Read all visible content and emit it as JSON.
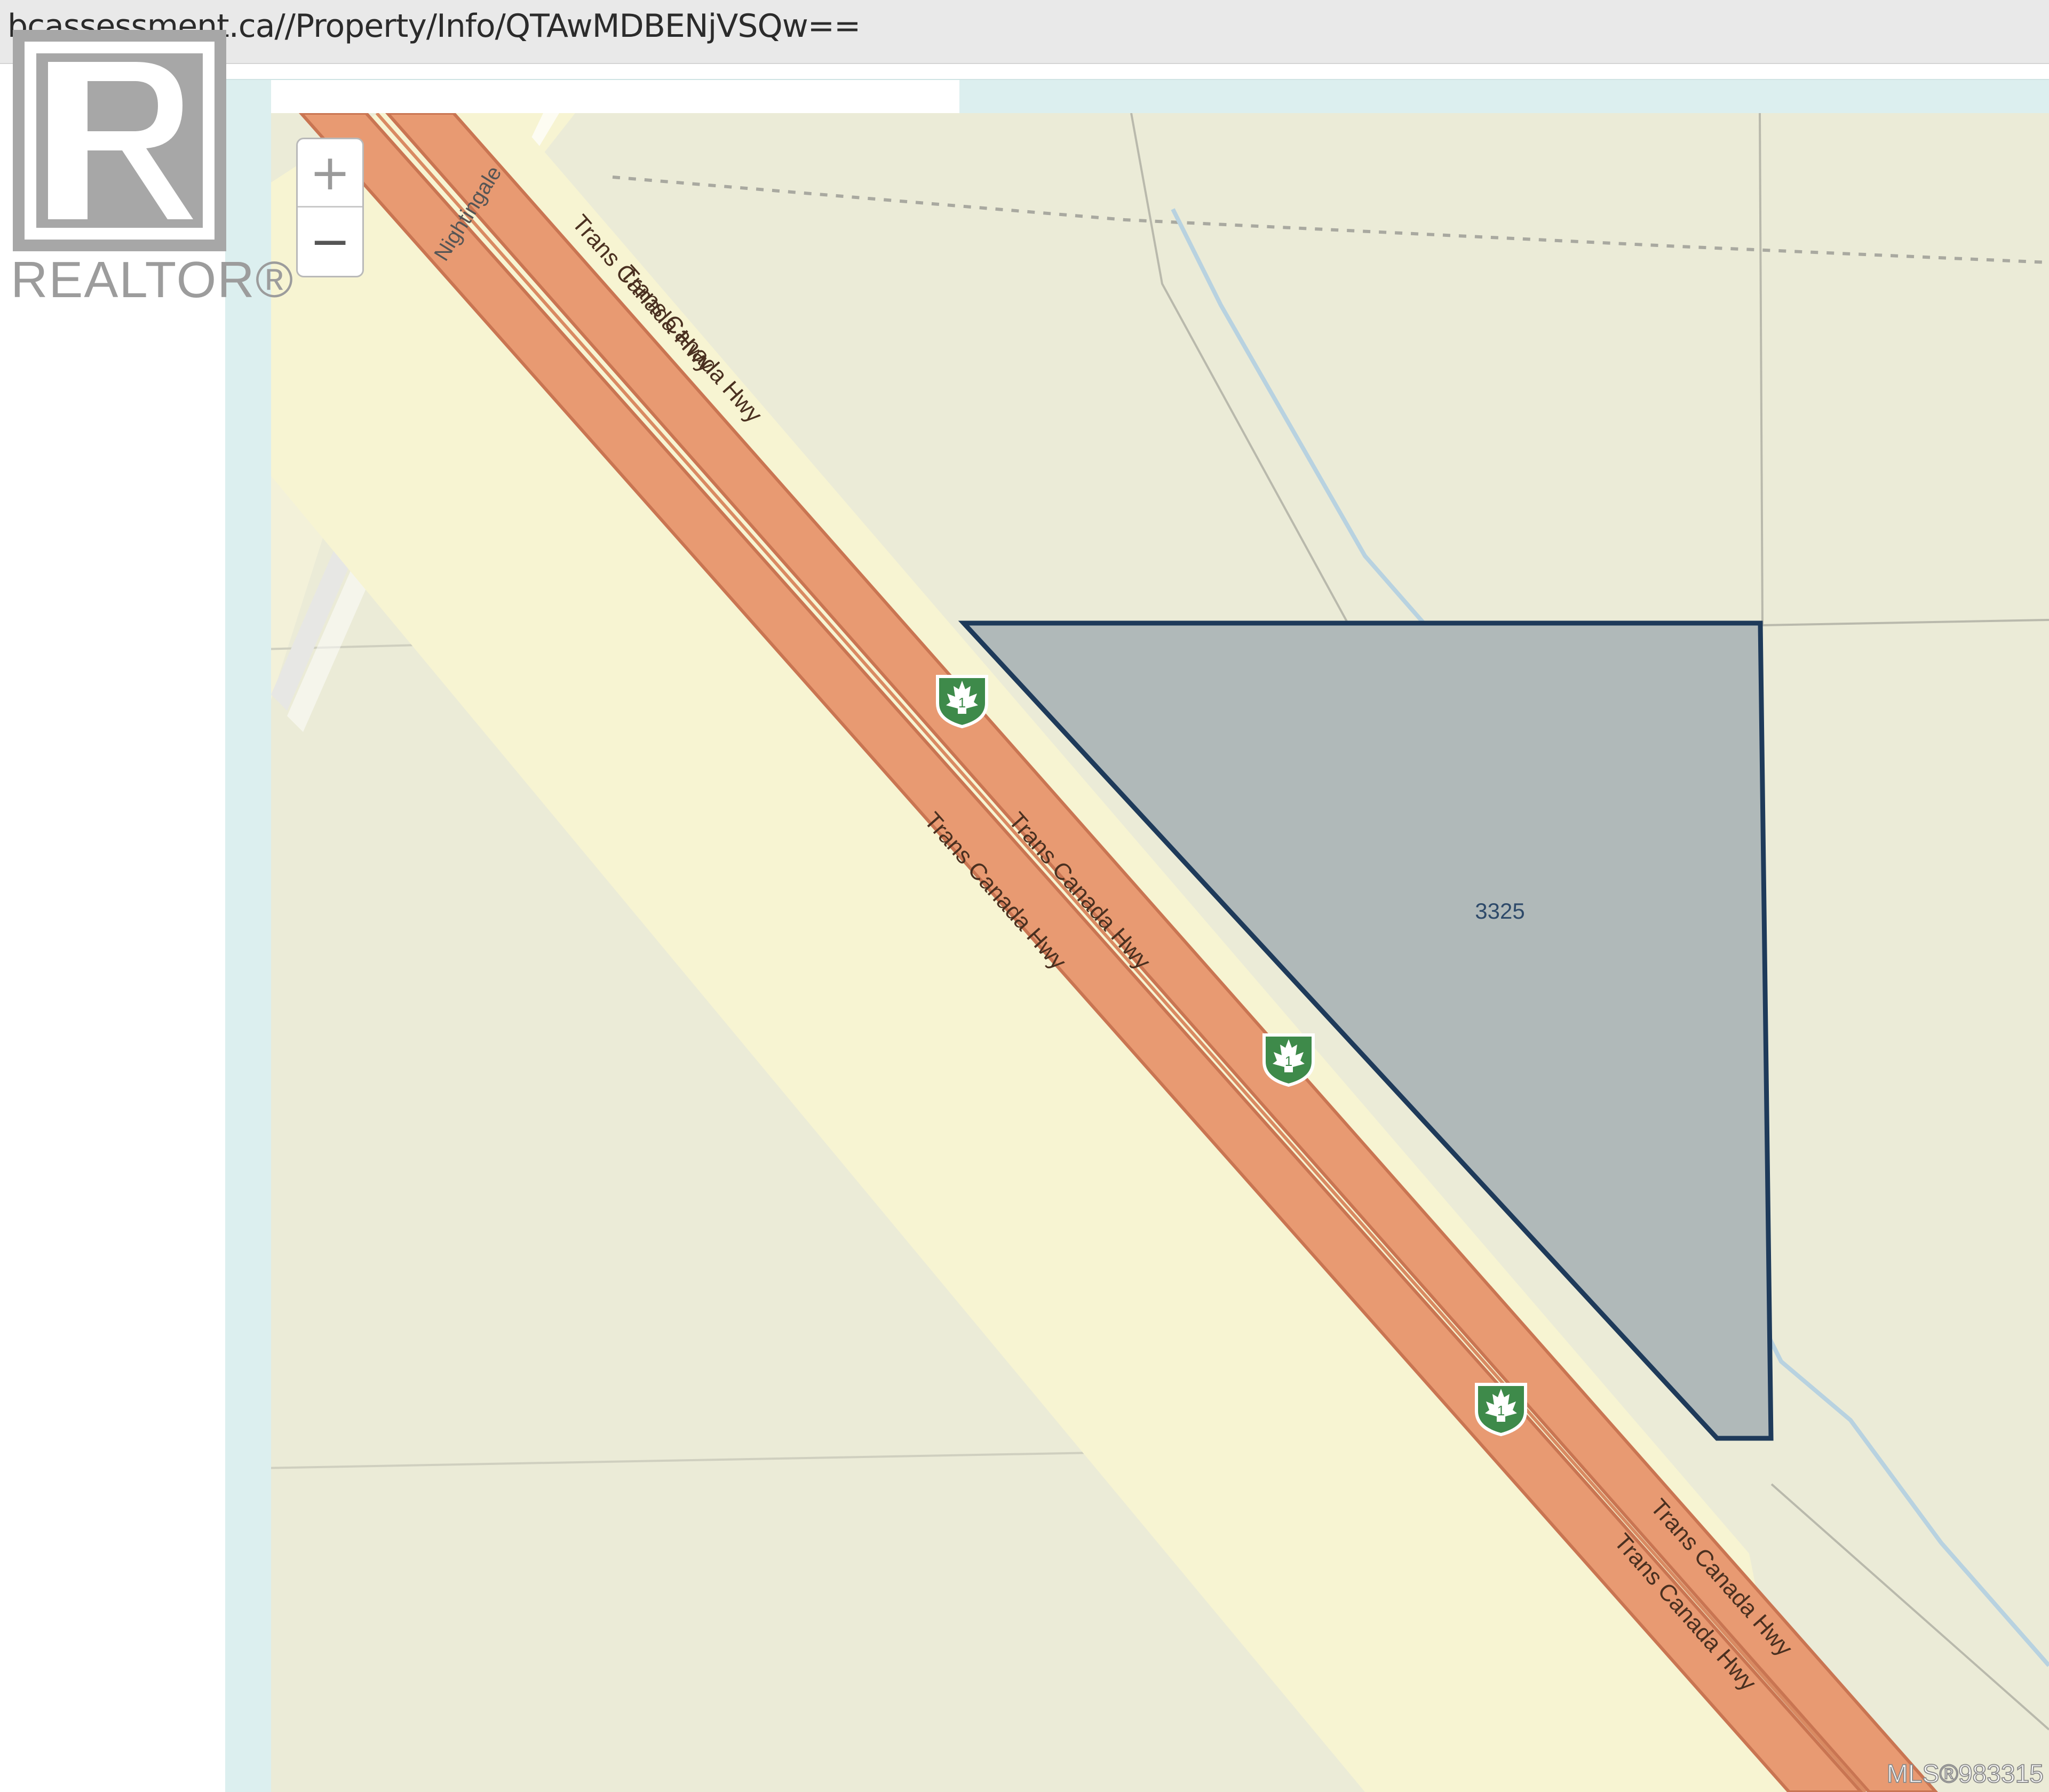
{
  "browser": {
    "url": "bcassessment.ca//Property/Info/QTAwMDBENjVSQw=="
  },
  "branding": {
    "logo_text": "REALTOR®",
    "mls_watermark": "MLS®983315"
  },
  "map": {
    "zoom_in_label": "+",
    "zoom_out_label": "−",
    "parcel_number": "3325",
    "road_labels": {
      "nightingale": "Nightingale",
      "hwy_label_1": "Trans Canada Hwy",
      "hwy_label_2": "Trans Canada Hwy",
      "hwy_label_3": "Trans Canada Hwy",
      "hwy_label_4": "Trans Canada Hwy",
      "hwy_label_5": "Trans Canada Hwy",
      "hwy_label_6": "Trans Canada Hwy"
    },
    "highway_shield_number": "1",
    "colors": {
      "land": "#ebebd7",
      "highway": "#e89a72",
      "highway_casing": "#c97552",
      "road_shoulder": "#f7f4d2",
      "parcel_fill": "#b0b9b9",
      "parcel_outline": "#1e3a5a",
      "stream": "#b8d2e0",
      "shield": "#3e8a4a"
    }
  }
}
